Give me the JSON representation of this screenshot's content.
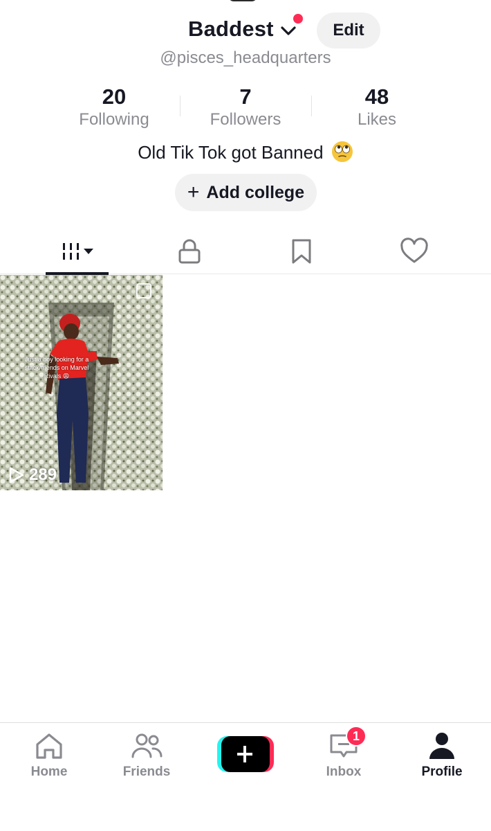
{
  "profile": {
    "display_name": "Baddest",
    "edit_label": "Edit",
    "handle": "@pisces_headquarters",
    "bio": "Old Tik Tok got Banned",
    "bio_emoji": "face-with-rolling-eyes",
    "add_college_label": "Add college"
  },
  "stats": [
    {
      "value": "20",
      "label": "Following"
    },
    {
      "value": "7",
      "label": "Followers"
    },
    {
      "value": "48",
      "label": "Likes"
    }
  ],
  "tabs": [
    {
      "icon": "grid-icon",
      "active": true
    },
    {
      "icon": "lock-icon",
      "active": false
    },
    {
      "icon": "bookmark-icon",
      "active": false
    },
    {
      "icon": "heart-icon",
      "active": false
    }
  ],
  "videos": [
    {
      "caption": "Just a boy looking for a stack/friends on Marvel Rivals 😩",
      "views": "289"
    }
  ],
  "bottom_nav": [
    {
      "label": "Home",
      "icon": "home-icon",
      "active": false
    },
    {
      "label": "Friends",
      "icon": "friends-icon",
      "active": false
    },
    {
      "label": "",
      "icon": "create-plus-icon",
      "active": false
    },
    {
      "label": "Inbox",
      "icon": "inbox-icon",
      "active": false,
      "badge": "1"
    },
    {
      "label": "Profile",
      "icon": "profile-icon",
      "active": true
    }
  ],
  "colors": {
    "accent": "#fe2c55",
    "text_primary": "#161823",
    "text_secondary": "#8a8b91",
    "button_bg": "#f1f1f2",
    "create_cyan": "#25f4ee"
  }
}
